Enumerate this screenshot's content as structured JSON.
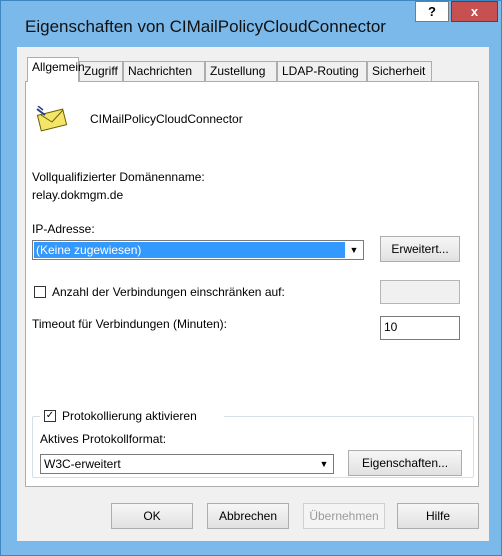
{
  "window": {
    "title": "Eigenschaften von CIMailPolicyCloudConnector",
    "help": "?",
    "close": "x"
  },
  "tabs": [
    "Allgemein",
    "Zugriff",
    "Nachrichten",
    "Zustellung",
    "LDAP-Routing",
    "Sicherheit"
  ],
  "general": {
    "connector_name": "CIMailPolicyCloudConnector",
    "fqdn_label": "Vollqualifizierter Domänenname:",
    "fqdn_value": "relay.dokmgm.de",
    "ip_label": "IP-Adresse:",
    "ip_value": "(Keine zugewiesen)",
    "advanced_button": "Erweitert...",
    "limit_connections_label": "Anzahl der Verbindungen einschränken auf:",
    "limit_connections_value": "",
    "timeout_label": "Timeout für Verbindungen (Minuten):",
    "timeout_value": "10",
    "logging_label": "Protokollierung aktivieren",
    "log_format_label": "Aktives Protokollformat:",
    "log_format_value": "W3C-erweitert",
    "properties_button": "Eigenschaften..."
  },
  "footer": {
    "ok": "OK",
    "cancel": "Abbrechen",
    "apply": "Übernehmen",
    "help": "Hilfe"
  },
  "icons": {
    "connector": "envelope-icon",
    "dropdown": "chevron-down-icon",
    "check": "checkmark-icon"
  },
  "colors": {
    "titlebar": "#7ab9ea",
    "selection": "#3399ff",
    "close": "#c75050"
  }
}
